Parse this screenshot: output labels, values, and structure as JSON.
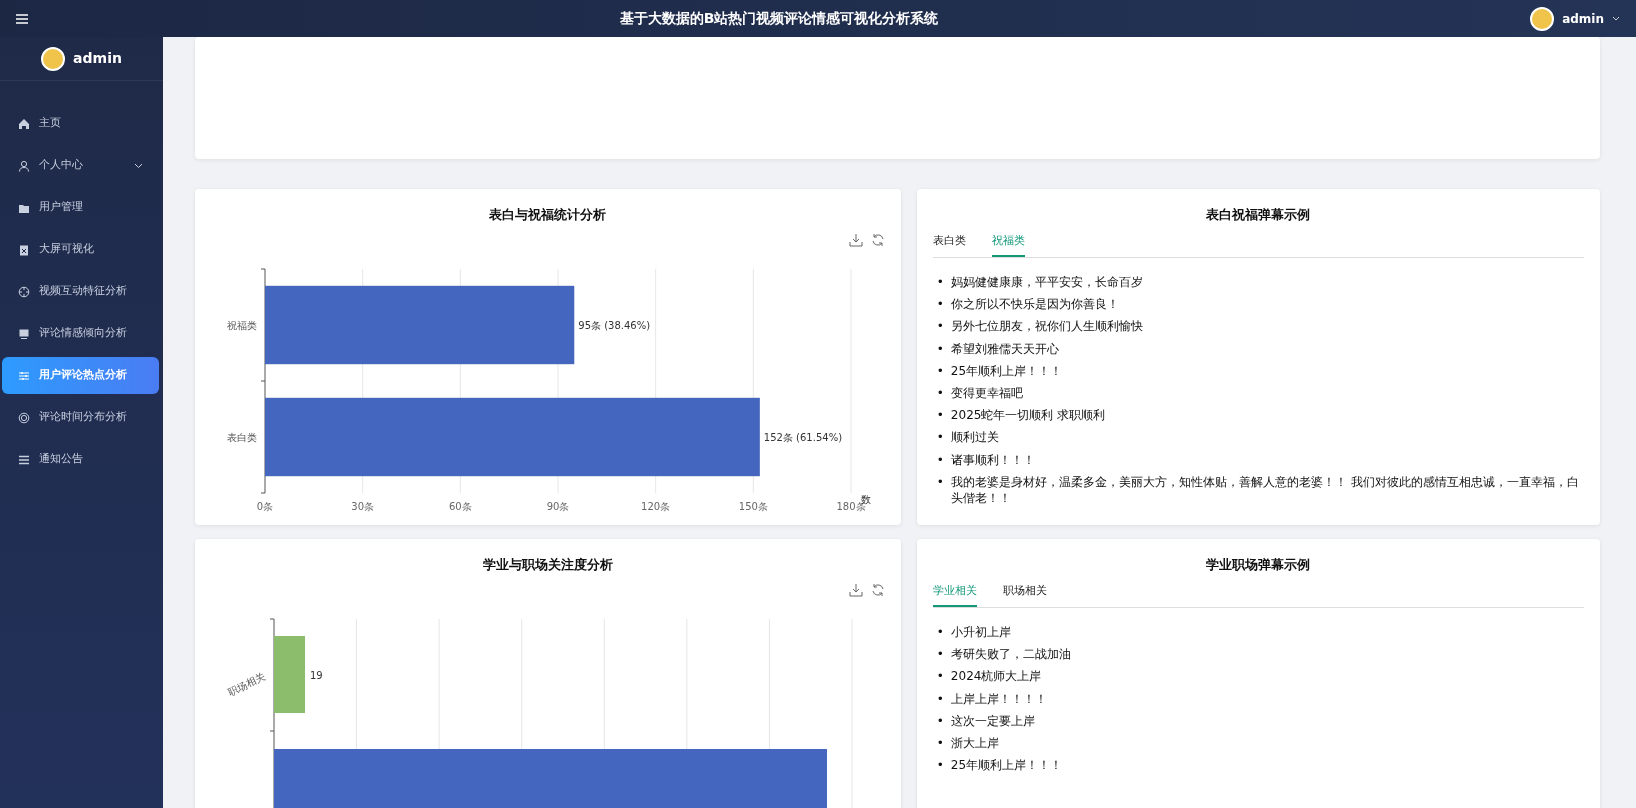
{
  "header": {
    "title": "基于大数据的B站热门视频评论情感可视化分析系统",
    "user": "admin"
  },
  "sidebar": {
    "user": "admin",
    "items": [
      {
        "label": "主页",
        "selected": false,
        "has_submenu": false
      },
      {
        "label": "个人中心",
        "selected": false,
        "has_submenu": true
      },
      {
        "label": "用户管理",
        "selected": false,
        "has_submenu": false
      },
      {
        "label": "大屏可视化",
        "selected": false,
        "has_submenu": false
      },
      {
        "label": "视频互动特征分析",
        "selected": false,
        "has_submenu": false
      },
      {
        "label": "评论情感倾向分析",
        "selected": false,
        "has_submenu": false
      },
      {
        "label": "用户评论热点分析",
        "selected": true,
        "has_submenu": false
      },
      {
        "label": "评论时间分布分析",
        "selected": false,
        "has_submenu": false
      },
      {
        "label": "通知公告",
        "selected": false,
        "has_submenu": false
      }
    ]
  },
  "panels": [
    {
      "kind": "chart",
      "title": "表白与祝福统计分析",
      "chart_data": {
        "type": "bar",
        "orientation": "horizontal",
        "grid": true,
        "xlabel": "数",
        "categories": [
          "祝福类",
          "表白类"
        ],
        "colors": [
          "#4566bf",
          "#4566bf"
        ],
        "series": [
          {
            "values": [
              95,
              152
            ]
          }
        ],
        "xlim": [
          0,
          180
        ],
        "xticks": [
          {
            "value": 0,
            "label": "0条"
          },
          {
            "value": 30,
            "label": "30条"
          },
          {
            "value": 60,
            "label": "60条"
          },
          {
            "value": 90,
            "label": "90条"
          },
          {
            "value": 120,
            "label": "120条"
          },
          {
            "value": 150,
            "label": "150条"
          },
          {
            "value": 180,
            "label": "180条"
          }
        ],
        "value_labels": [
          "95条 (38.46%)",
          "152条 (61.54%)"
        ]
      }
    },
    {
      "kind": "list",
      "title": "表白祝福弹幕示例",
      "marker": "•",
      "tabs": [
        {
          "label": "表白类",
          "selected": false
        },
        {
          "label": "祝福类",
          "selected": true
        }
      ],
      "items": [
        "妈妈健健康康，平平安安，长命百岁",
        "你之所以不快乐是因为你善良！",
        "另外七位朋友，祝你们人生顺利愉快",
        "希望刘雅儒天天开心",
        "25年顺利上岸！！！",
        "变得更幸福吧",
        "2025蛇年一切顺利 求职顺利",
        "顺利过关",
        "诸事顺利！！！",
        "我的老婆是身材好，温柔多金，美丽大方，知性体贴，善解人意的老婆！！ 我们对彼此的感情互相忠诚，一直幸福，白头偕老！！"
      ]
    },
    {
      "kind": "chart_picture",
      "title": "学业与职场关注度分析",
      "category_label": "职场相关",
      "value_label": "19"
    },
    {
      "kind": "list",
      "title": "学业职场弹幕示例",
      "marker": "•",
      "tabs": [
        {
          "label": "学业相关",
          "selected": true
        },
        {
          "label": "职场相关",
          "selected": false
        }
      ],
      "items": [
        "小升初上岸",
        "考研失败了，二战加油",
        "2024杭师大上岸",
        "上岸上岸！！！！",
        "这次一定要上岸",
        "浙大上岸",
        "25年顺利上岸！！！"
      ]
    }
  ]
}
